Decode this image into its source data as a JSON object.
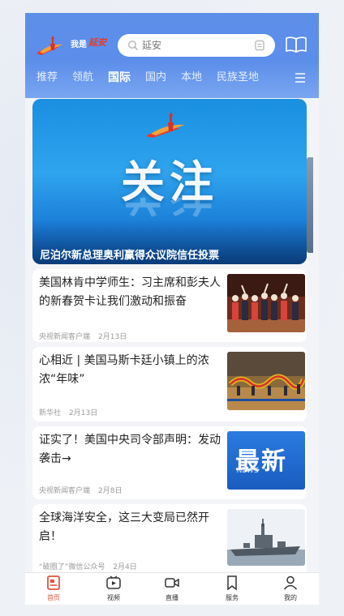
{
  "header": {
    "logo_text": "我是",
    "logo_text_accent": "延安",
    "search_placeholder": "延安",
    "tabs": [
      {
        "label": "推荐"
      },
      {
        "label": "领航"
      },
      {
        "label": "国际"
      },
      {
        "label": "国内"
      },
      {
        "label": "本地"
      },
      {
        "label": "民族圣地"
      }
    ],
    "active_tab": "国际"
  },
  "banner": {
    "headline": "关注",
    "caption": "尼泊尔新总理奥利赢得众议院信任投票"
  },
  "articles": [
    {
      "title": "美国林肯中学师生：习主席和彭夫人的新春贺卡让我们激动和振奋",
      "source": "央视新闻客户端",
      "date": "2月13日"
    },
    {
      "title": "心相近 | 美国马斯卡廷小镇上的浓浓“年味”",
      "source": "新华社",
      "date": "2月13日"
    },
    {
      "title": "证实了！美国中央司令部声明：发动袭击→",
      "source": "央视新闻客户端",
      "date": "2月8日",
      "thumb_text": "最新",
      "thumb_text_small": "NEWS"
    },
    {
      "title": "全球海洋安全，这三大变局已然开启！",
      "source": "“破圈了”微信公众号",
      "date": "2月4日"
    }
  ],
  "bottom_nav": [
    {
      "label": "首页",
      "icon": "home-news-icon"
    },
    {
      "label": "视频",
      "icon": "video-play-icon"
    },
    {
      "label": "直播",
      "icon": "camera-live-icon"
    },
    {
      "label": "服务",
      "icon": "bookmark-service-icon"
    },
    {
      "label": "我的",
      "icon": "user-icon"
    }
  ],
  "colors": {
    "header_blue": "#5b8dea",
    "accent_red": "#e5533c",
    "banner_blue": "#1a8fe0"
  }
}
